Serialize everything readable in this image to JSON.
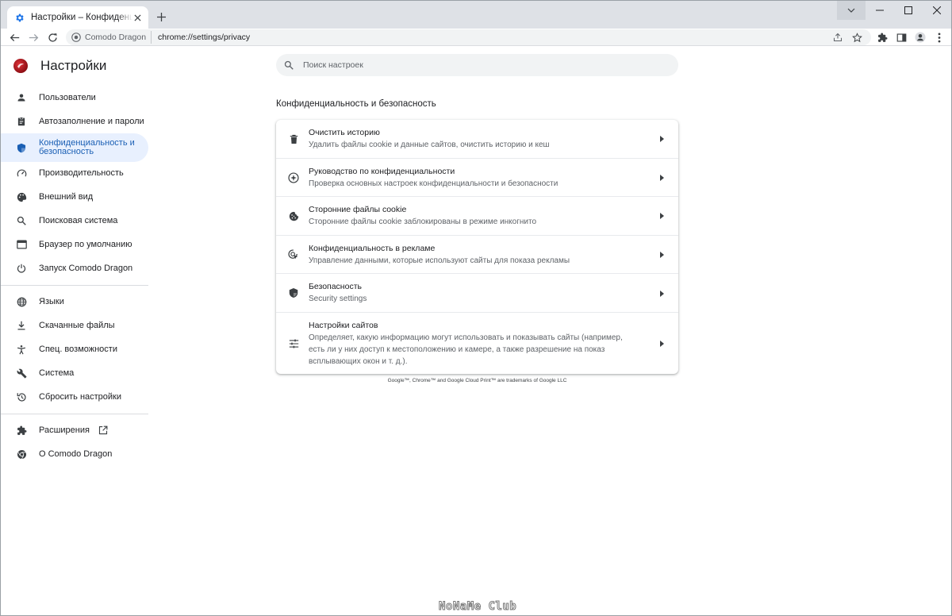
{
  "tab": {
    "title": "Настройки – Конфиденциальность и безопасность"
  },
  "toolbar": {
    "site_chip": "Comodo Dragon",
    "url": "chrome://settings/privacy"
  },
  "sidebar": {
    "brand": "Настройки",
    "items": [
      {
        "label": "Пользователи",
        "icon": "person-icon"
      },
      {
        "label": "Автозаполнение и пароли",
        "icon": "clipboard-icon"
      },
      {
        "label": "Конфиденциальность и безопасность",
        "icon": "shield-icon",
        "active": true
      },
      {
        "label": "Производительность",
        "icon": "speedometer-icon"
      },
      {
        "label": "Внешний вид",
        "icon": "palette-icon"
      },
      {
        "label": "Поисковая система",
        "icon": "search-icon"
      },
      {
        "label": "Браузер по умолчанию",
        "icon": "browser-icon"
      },
      {
        "label": "Запуск Comodo Dragon",
        "icon": "power-icon"
      },
      {
        "label": "Языки",
        "icon": "globe-icon"
      },
      {
        "label": "Скачанные файлы",
        "icon": "download-icon"
      },
      {
        "label": "Спец. возможности",
        "icon": "accessibility-icon"
      },
      {
        "label": "Система",
        "icon": "wrench-icon"
      },
      {
        "label": "Сбросить настройки",
        "icon": "history-icon"
      },
      {
        "label": "Расширения",
        "icon": "puzzle-icon"
      },
      {
        "label": "О Comodo Dragon",
        "icon": "chrome-icon"
      }
    ]
  },
  "search": {
    "placeholder": "Поиск настроек"
  },
  "section": {
    "title": "Конфиденциальность и безопасность"
  },
  "rows": [
    {
      "title": "Очистить историю",
      "sub": "Удалить файлы cookie и данные сайтов, очистить историю и кеш",
      "icon": "trash-icon"
    },
    {
      "title": "Руководство по конфиденциальности",
      "sub": "Проверка основных настроек конфиденциальности и безопасности",
      "icon": "compass-icon"
    },
    {
      "title": "Сторонние файлы cookie",
      "sub": "Сторонние файлы cookie заблокированы в режиме инкогнито",
      "icon": "cookie-icon"
    },
    {
      "title": "Конфиденциальность в рекламе",
      "sub": "Управление данными, которые используют сайты для показа рекламы",
      "icon": "ad-privacy-icon"
    },
    {
      "title": "Безопасность",
      "sub": "Security settings",
      "icon": "security-shield-icon"
    },
    {
      "title": "Настройки сайтов",
      "sub": "Определяет, какую информацию могут использовать и показывать сайты (например, есть ли у них доступ к местоположению и камере, а также разрешение на показ всплывающих окон и т. д.).",
      "icon": "tune-icon"
    }
  ],
  "footer": {
    "trademark": "Google™, Chrome™ and Google Cloud Print™ are trademarks of Google LLC"
  },
  "watermark": "NoNaMe Club"
}
